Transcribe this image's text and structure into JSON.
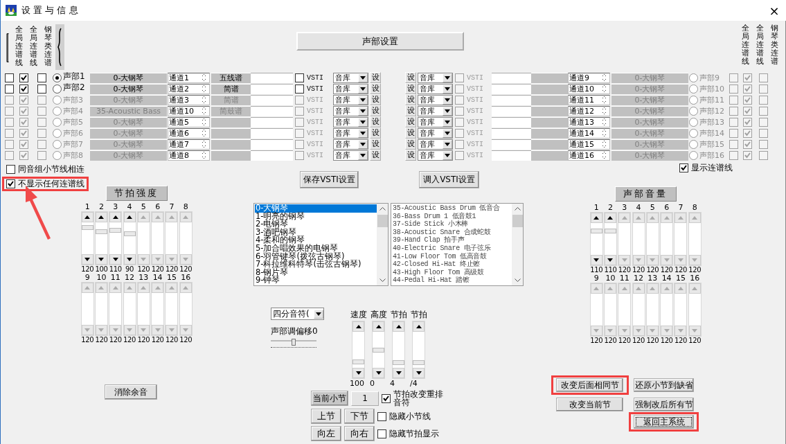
{
  "window": {
    "title": "设 置 与 信 息",
    "close": "×"
  },
  "link_headers_left": [
    "全局连谱线",
    "全局连谱线",
    "钢琴类连谱"
  ],
  "voice_settings_button": "声部设置",
  "link_headers_right": [
    "全局连谱线",
    "全局连谱线",
    "钢琴类连谱"
  ],
  "voices_left": [
    {
      "label": "声部1",
      "selected": true,
      "disabled": false,
      "global_link_1": false,
      "global_link_2": true,
      "piano_link": false,
      "instrument": "0-大钢琴",
      "channel": "通道1",
      "notation": "五线谱",
      "vsti": false,
      "vsti_label": "VSTI",
      "bank": "音库",
      "set_label": "设"
    },
    {
      "label": "声部2",
      "selected": false,
      "disabled": false,
      "global_link_1": false,
      "global_link_2": true,
      "piano_link": false,
      "instrument": "0-大钢琴",
      "channel": "通道2",
      "notation": "简谱",
      "vsti": false,
      "vsti_label": "VSTI",
      "bank": "音库",
      "set_label": "设"
    },
    {
      "label": "声部3",
      "selected": false,
      "disabled": true,
      "global_link_1": false,
      "global_link_2": true,
      "piano_link": false,
      "instrument": "0-大钢琴",
      "channel": "通道3",
      "notation": "简谱",
      "vsti": false,
      "vsti_label": "VSTI",
      "bank": "音库",
      "set_label": "设"
    },
    {
      "label": "声部4",
      "selected": false,
      "disabled": true,
      "global_link_1": false,
      "global_link_2": true,
      "piano_link": false,
      "instrument": "35-Acoustic Bass",
      "channel": "通道10",
      "notation": "简鼓谱",
      "vsti": false,
      "vsti_label": "VSTI",
      "bank": "音库",
      "set_label": "设"
    },
    {
      "label": "声部5",
      "selected": false,
      "disabled": true,
      "global_link_1": false,
      "global_link_2": true,
      "piano_link": false,
      "instrument": "0-大钢琴",
      "channel": "通道5",
      "vsti": false,
      "vsti_label": "VSTI",
      "bank": "音库",
      "set_label": "设"
    },
    {
      "label": "声部6",
      "selected": false,
      "disabled": true,
      "global_link_1": false,
      "global_link_2": true,
      "piano_link": false,
      "instrument": "0-大钢琴",
      "channel": "通道6",
      "vsti": false,
      "vsti_label": "VSTI",
      "bank": "音库",
      "set_label": "设"
    },
    {
      "label": "声部7",
      "selected": false,
      "disabled": true,
      "global_link_1": false,
      "global_link_2": true,
      "piano_link": false,
      "instrument": "0-大钢琴",
      "channel": "通道7",
      "vsti": false,
      "vsti_label": "VSTI",
      "bank": "音库",
      "set_label": "设"
    },
    {
      "label": "声部8",
      "selected": false,
      "disabled": true,
      "global_link_1": false,
      "global_link_2": true,
      "piano_link": false,
      "instrument": "0-大钢琴",
      "channel": "通道8",
      "vsti": false,
      "vsti_label": "VSTI",
      "bank": "音库",
      "set_label": "设"
    }
  ],
  "voices_right": [
    {
      "label": "声部9",
      "selected": false,
      "disabled": true,
      "global_link_1": false,
      "global_link_2": true,
      "piano_link": false,
      "instrument": "0-大钢琴",
      "channel": "通道9",
      "vsti": false,
      "vsti_label": "VSTI",
      "bank": "音库",
      "set_label": "设"
    },
    {
      "label": "声部10",
      "selected": false,
      "disabled": true,
      "global_link_1": false,
      "global_link_2": true,
      "piano_link": false,
      "instrument": "0-大钢琴",
      "channel": "通道10",
      "vsti": false,
      "vsti_label": "VSTI",
      "bank": "音库",
      "set_label": "设"
    },
    {
      "label": "声部11",
      "selected": false,
      "disabled": true,
      "global_link_1": false,
      "global_link_2": true,
      "piano_link": false,
      "instrument": "0-大钢琴",
      "channel": "通道11",
      "vsti": false,
      "vsti_label": "VSTI",
      "bank": "音库",
      "set_label": "设"
    },
    {
      "label": "声部12",
      "selected": false,
      "disabled": true,
      "global_link_1": false,
      "global_link_2": true,
      "piano_link": false,
      "instrument": "0-大钢琴",
      "channel": "通道12",
      "vsti": false,
      "vsti_label": "VSTI",
      "bank": "音库",
      "set_label": "设"
    },
    {
      "label": "声部13",
      "selected": false,
      "disabled": true,
      "global_link_1": false,
      "global_link_2": true,
      "piano_link": false,
      "instrument": "0-大钢琴",
      "channel": "通道13",
      "vsti": false,
      "vsti_label": "VSTI",
      "bank": "音库",
      "set_label": "设"
    },
    {
      "label": "声部14",
      "selected": false,
      "disabled": true,
      "global_link_1": false,
      "global_link_2": true,
      "piano_link": false,
      "instrument": "0-大钢琴",
      "channel": "通道14",
      "vsti": false,
      "vsti_label": "VSTI",
      "bank": "音库",
      "set_label": "设"
    },
    {
      "label": "声部15",
      "selected": false,
      "disabled": true,
      "global_link_1": false,
      "global_link_2": true,
      "piano_link": false,
      "instrument": "0-大钢琴",
      "channel": "通道15",
      "vsti": false,
      "vsti_label": "VSTI",
      "bank": "音库",
      "set_label": "设"
    },
    {
      "label": "声部16",
      "selected": false,
      "disabled": true,
      "global_link_1": false,
      "global_link_2": true,
      "piano_link": false,
      "instrument": "0-大钢琴",
      "channel": "通道16",
      "vsti": false,
      "vsti_label": "VSTI",
      "bank": "音库",
      "set_label": "设"
    }
  ],
  "options": [
    {
      "label": "同音组小节线相连",
      "checked": false,
      "highlighted": false
    },
    {
      "label": "不显示任何连谱线",
      "checked": true,
      "highlighted": true
    }
  ],
  "show_links": {
    "label": "显示连谱线",
    "checked": true
  },
  "save_vsti": "保存VSTI设置",
  "load_vsti": "调入VSTI设置",
  "beat_strength": {
    "title": "节拍强度",
    "rows": [
      [
        {
          "number": "1",
          "value": "120",
          "disabled": false,
          "level": 0.9
        },
        {
          "number": "2",
          "value": "100",
          "disabled": false,
          "level": 0.74
        },
        {
          "number": "3",
          "value": "110",
          "disabled": false,
          "level": 0.8
        },
        {
          "number": "4",
          "value": "90",
          "disabled": false,
          "level": 0.66
        },
        {
          "number": "5",
          "value": "120",
          "disabled": true
        },
        {
          "number": "6",
          "value": "120",
          "disabled": true
        },
        {
          "number": "7",
          "value": "120",
          "disabled": true
        },
        {
          "number": "8",
          "value": "120",
          "disabled": true
        }
      ],
      [
        {
          "number": "9",
          "value": "120",
          "disabled": true
        },
        {
          "number": "10",
          "value": "120",
          "disabled": true
        },
        {
          "number": "11",
          "value": "120",
          "disabled": true
        },
        {
          "number": "12",
          "value": "120",
          "disabled": true
        },
        {
          "number": "13",
          "value": "120",
          "disabled": true
        },
        {
          "number": "14",
          "value": "120",
          "disabled": true
        },
        {
          "number": "15",
          "value": "120",
          "disabled": true
        },
        {
          "number": "16",
          "value": "120",
          "disabled": true
        }
      ]
    ]
  },
  "voice_volume": {
    "title": "声部音量",
    "rows": [
      [
        {
          "number": "1",
          "value": "110",
          "disabled": false,
          "level": 0.8
        },
        {
          "number": "2",
          "value": "110",
          "disabled": false,
          "level": 0.8
        },
        {
          "number": "3",
          "value": "120",
          "disabled": true
        },
        {
          "number": "4",
          "value": "120",
          "disabled": true
        },
        {
          "number": "5",
          "value": "120",
          "disabled": true
        },
        {
          "number": "6",
          "value": "120",
          "disabled": true
        },
        {
          "number": "7",
          "value": "120",
          "disabled": true
        },
        {
          "number": "8",
          "value": "120",
          "disabled": true
        }
      ],
      [
        {
          "number": "9",
          "value": "120",
          "disabled": true
        },
        {
          "number": "10",
          "value": "120",
          "disabled": true
        },
        {
          "number": "11",
          "value": "120",
          "disabled": true
        },
        {
          "number": "12",
          "value": "120",
          "disabled": true
        },
        {
          "number": "13",
          "value": "120",
          "disabled": true
        },
        {
          "number": "14",
          "value": "120",
          "disabled": true
        },
        {
          "number": "15",
          "value": "120",
          "disabled": true
        },
        {
          "number": "16",
          "value": "120",
          "disabled": true
        }
      ]
    ]
  },
  "instrument_list": [
    {
      "label": "0-大钢琴",
      "selected": true
    },
    {
      "label": "1-明亮的钢琴",
      "selected": false
    },
    {
      "label": "2-电钢琴",
      "selected": false
    },
    {
      "label": "3-酒吧钢琴",
      "selected": false
    },
    {
      "label": "4-柔和的钢琴",
      "selected": false
    },
    {
      "label": "5-加合唱效果的电钢琴",
      "selected": false
    },
    {
      "label": "6-羽管键琴(拨弦古钢琴)",
      "selected": false
    },
    {
      "label": "7-科拉维科特琴(击弦古钢琴)",
      "selected": false
    },
    {
      "label": "8-钢片琴",
      "selected": false
    },
    {
      "label": "9-钟琴",
      "selected": false
    }
  ],
  "drum_list": [
    {
      "label": "35-Acoustic Bass Drum  低音合",
      "selected": false
    },
    {
      "label": "36-Bass Drum 1 低音鼓1",
      "selected": false
    },
    {
      "label": "37-Side Stick 小木棒",
      "selected": false
    },
    {
      "label": "38-Acoustic Snare 合成蛇鼓",
      "selected": false
    },
    {
      "label": "39-Hand Clap 拍手声",
      "selected": false
    },
    {
      "label": "40-Electric Snare 电子弦乐",
      "selected": false
    },
    {
      "label": "41-Low Floor Tom 低高音鼓",
      "selected": false
    },
    {
      "label": "42-Closed Hi-Hat 终止镲",
      "selected": false
    },
    {
      "label": "43-High Floor Tom 高级鼓",
      "selected": false
    },
    {
      "label": "44-Pedal Hi-Hat 踏镲",
      "selected": false
    }
  ],
  "note_value": "四分音符(",
  "transpose": {
    "label": "声部调偏移0",
    "level": 0.5
  },
  "sliders": [
    {
      "label": "速度",
      "value": "100",
      "level": 0.12
    },
    {
      "label": "高度",
      "value": "0",
      "level": 0.5
    },
    {
      "label": "节拍",
      "value": "4",
      "level": 0.1
    },
    {
      "label": "节拍",
      "value": "/4",
      "level": 0.1
    }
  ],
  "clear_button": "消除余音",
  "measure": {
    "button": "当前小节",
    "value": "1"
  },
  "rearrange": {
    "label": "节拍改变重排音符",
    "checked": true
  },
  "nav_buttons": [
    "上节",
    "下节",
    "向左",
    "向右"
  ],
  "hide_options": [
    {
      "label": "隐藏小节线",
      "checked": false
    },
    {
      "label": "隐藏节拍显示",
      "checked": false
    }
  ],
  "action_buttons": [
    {
      "label": "改变后面相同节",
      "highlighted": true,
      "focused": false
    },
    {
      "label": "还原小节到缺省",
      "highlighted": false,
      "focused": false
    },
    {
      "label": "改变当前节",
      "highlighted": false,
      "focused": false
    },
    {
      "label": "强制改后所有节",
      "highlighted": false,
      "focused": false
    },
    {
      "label": "返回主系统",
      "highlighted": true,
      "focused": true
    }
  ]
}
